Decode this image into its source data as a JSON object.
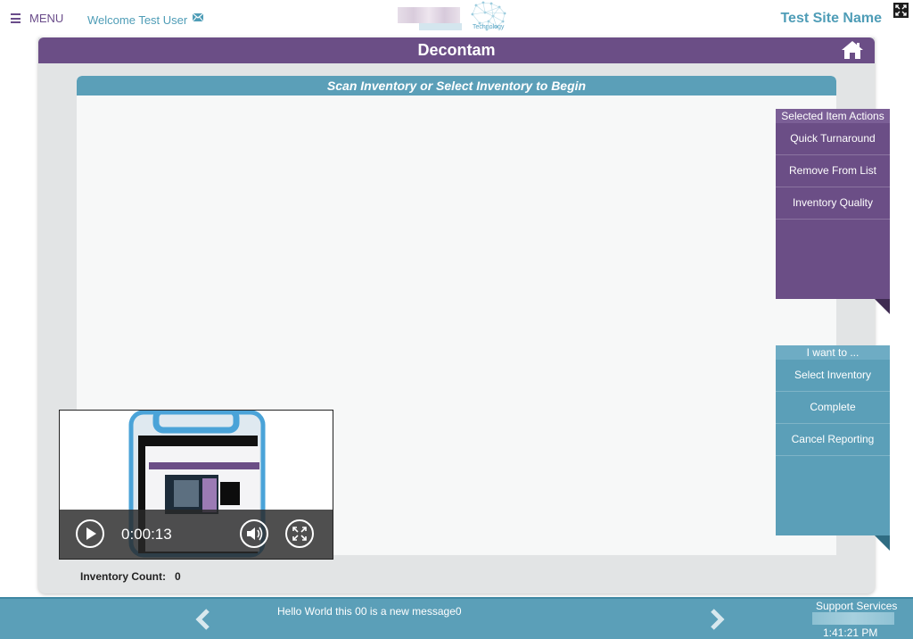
{
  "header": {
    "menu_label": "MENU",
    "welcome": "Welcome Test User",
    "logo_text": "Technology",
    "site_name": "Test Site Name"
  },
  "page": {
    "title": "Decontam",
    "prompt": "Scan Inventory or Select Inventory to Begin",
    "count_label": "Inventory Count:",
    "count_value": "0"
  },
  "selected_item_actions": {
    "header": "Selected Item Actions",
    "items": [
      "Quick Turnaround",
      "Remove From List",
      "Inventory Quality"
    ]
  },
  "i_want_to": {
    "header": "I want to ...",
    "items": [
      "Select Inventory",
      "Complete",
      "Cancel Reporting"
    ]
  },
  "video": {
    "time": "0:00:13",
    "icons": [
      "play-icon",
      "volume-icon",
      "fullscreen-icon"
    ]
  },
  "footer": {
    "message": "Hello World this 00 is a new message0",
    "support": "Support Services",
    "time": "1:41:21 PM"
  },
  "colors": {
    "purple": "#6b4e86",
    "teal": "#5b9fb8",
    "panel": "#e2e4e5"
  }
}
